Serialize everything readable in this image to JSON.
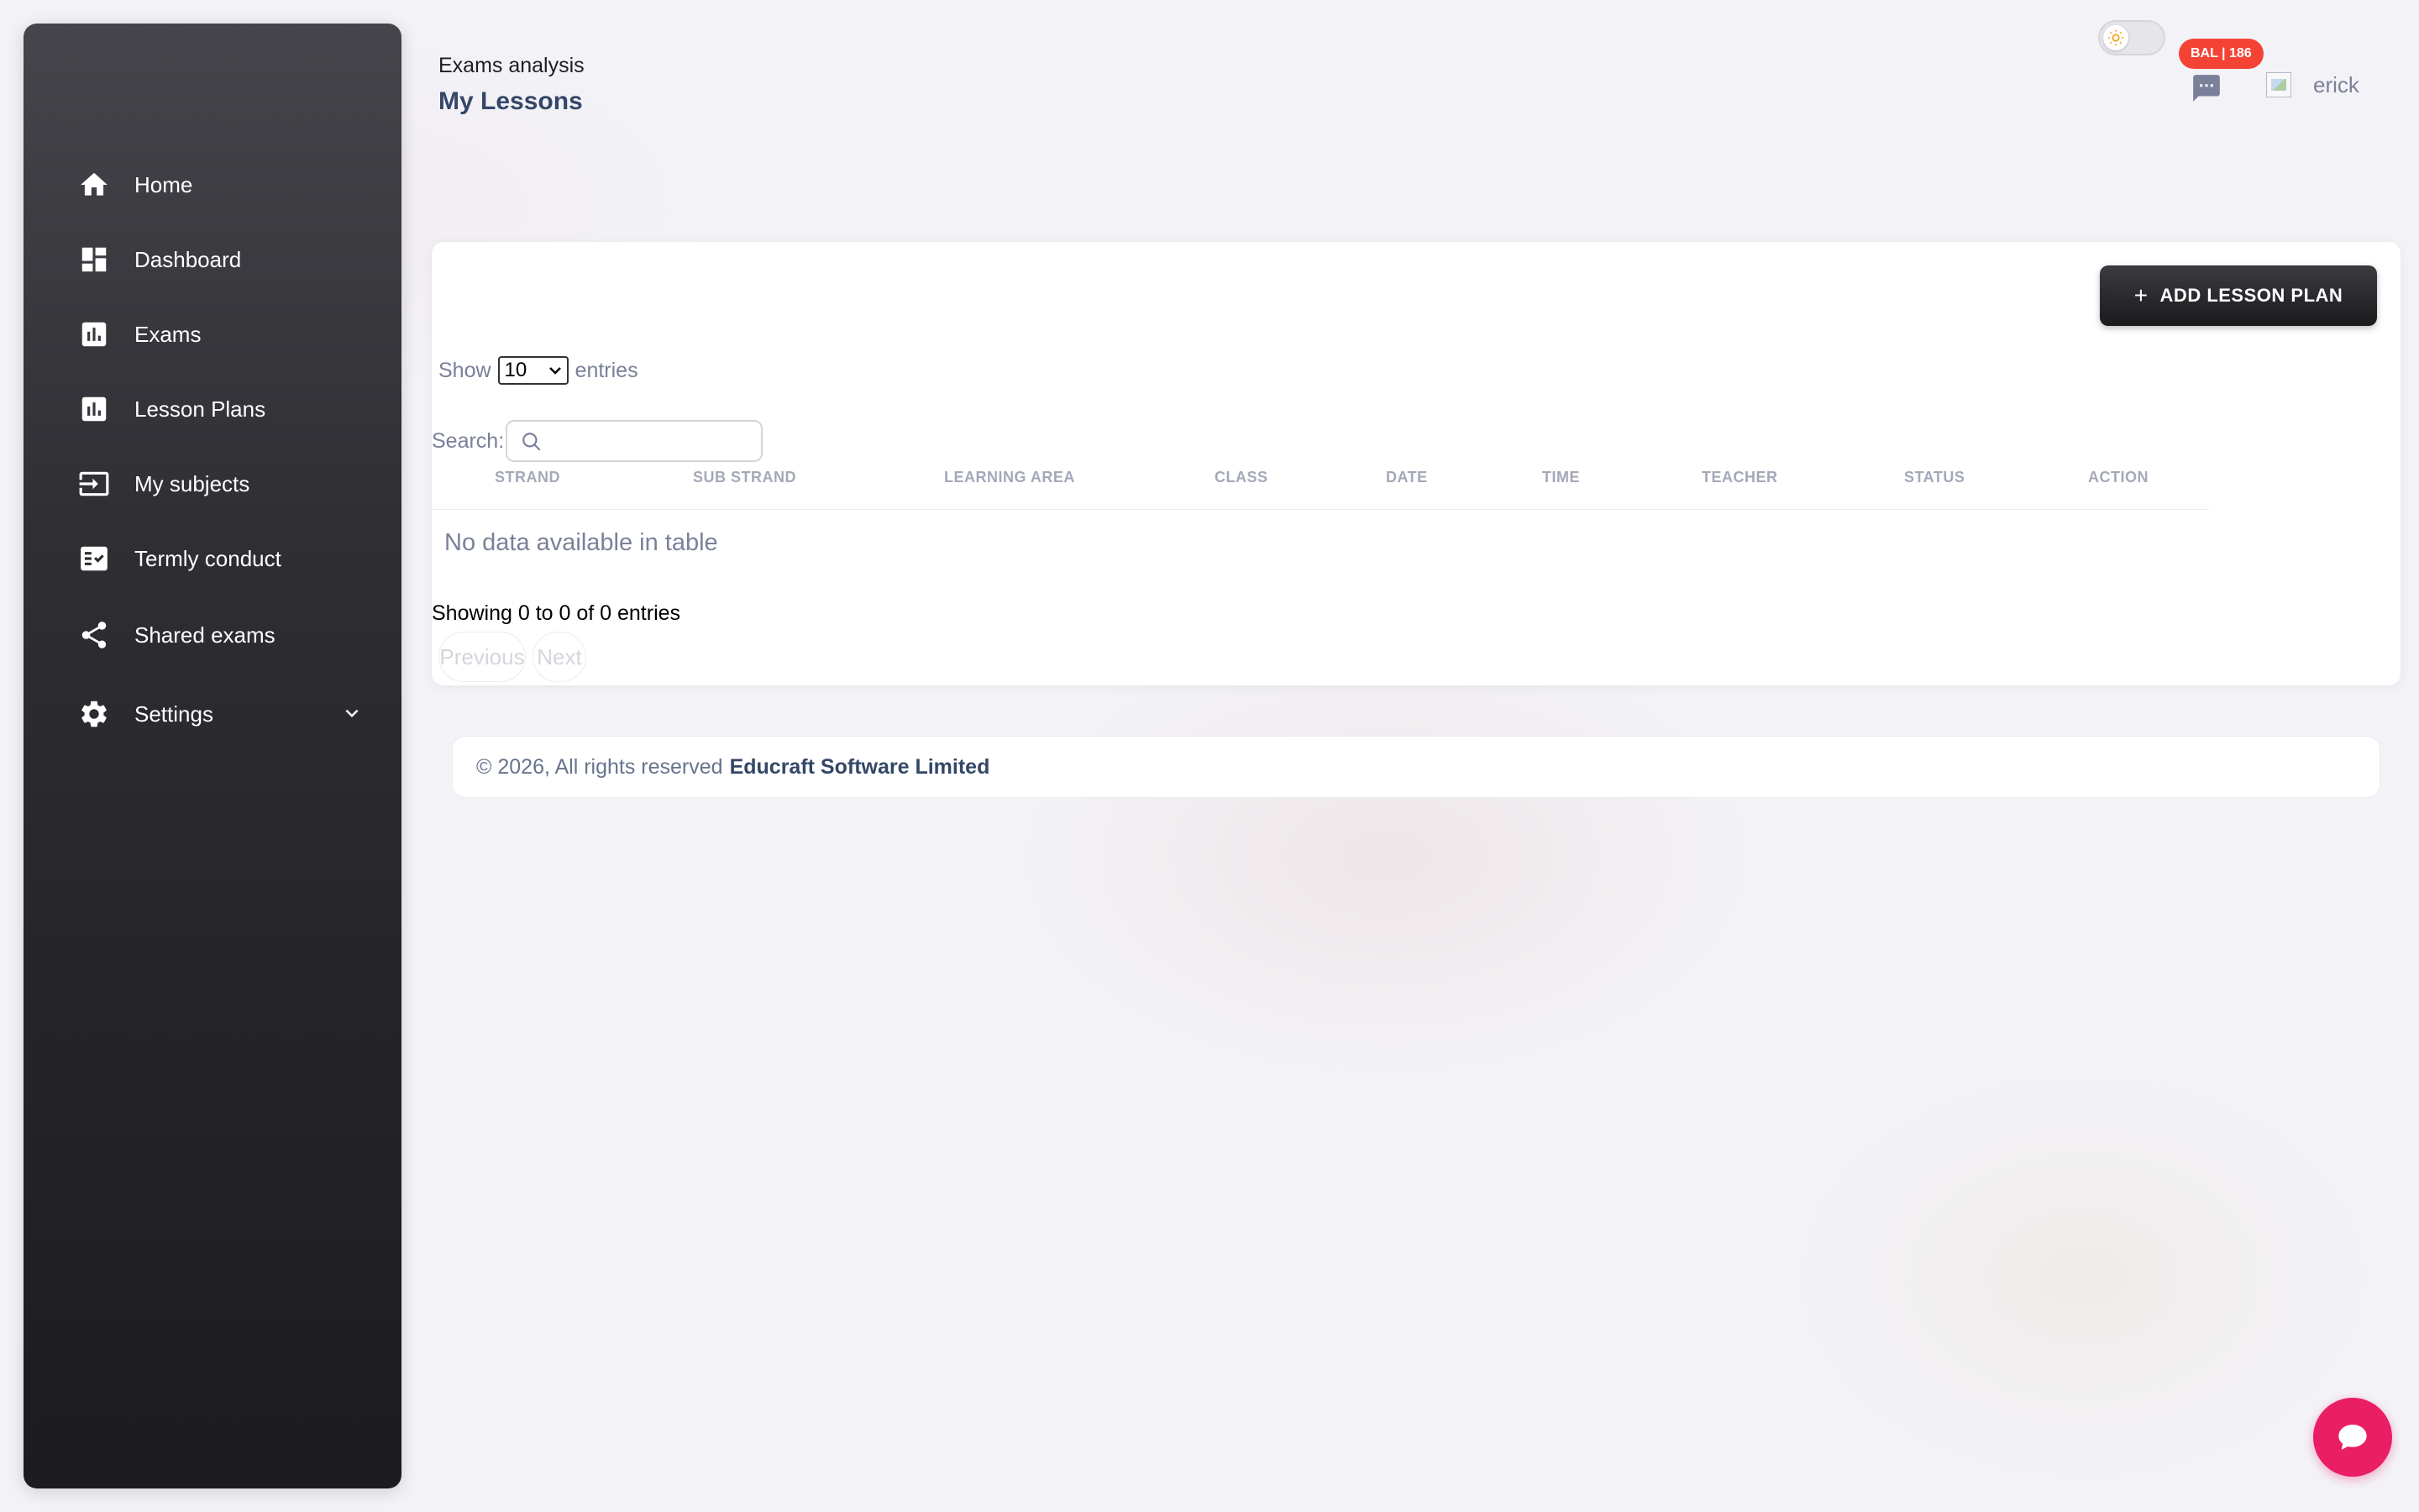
{
  "sidebar": {
    "items": [
      {
        "label": "Home",
        "icon": "home-icon"
      },
      {
        "label": "Dashboard",
        "icon": "dashboard-icon"
      },
      {
        "label": "Exams",
        "icon": "bar-chart-icon"
      },
      {
        "label": "Lesson Plans",
        "icon": "bar-chart-icon"
      },
      {
        "label": "My subjects",
        "icon": "input-icon"
      },
      {
        "label": "Termly conduct",
        "icon": "checklist-icon"
      },
      {
        "label": "Shared exams",
        "icon": "share-icon"
      },
      {
        "label": "Settings",
        "icon": "gear-icon"
      }
    ]
  },
  "header": {
    "breadcrumb": "Exams analysis",
    "title": "My Lessons",
    "balance_badge": "BAL | 186",
    "username": "erick"
  },
  "card": {
    "add_button_label": "ADD LESSON PLAN",
    "show_label": "Show",
    "entries_value": "10",
    "entries_label": "entries",
    "search_label": "Search:",
    "search_value": "",
    "columns": [
      "STRAND",
      "SUB STRAND",
      "LEARNING AREA",
      "CLASS",
      "DATE",
      "TIME",
      "TEACHER",
      "STATUS",
      "ACTION"
    ],
    "empty_message": "No data available in table",
    "info": "Showing 0 to 0 of 0 entries",
    "prev_label": "Previous",
    "next_label": "Next"
  },
  "footer": {
    "copyright": "© 2026, All rights reserved",
    "company": "Educraft Software Limited"
  },
  "colors": {
    "accent": "#344767",
    "badge": "#f44335",
    "fab": "#e91e63"
  }
}
